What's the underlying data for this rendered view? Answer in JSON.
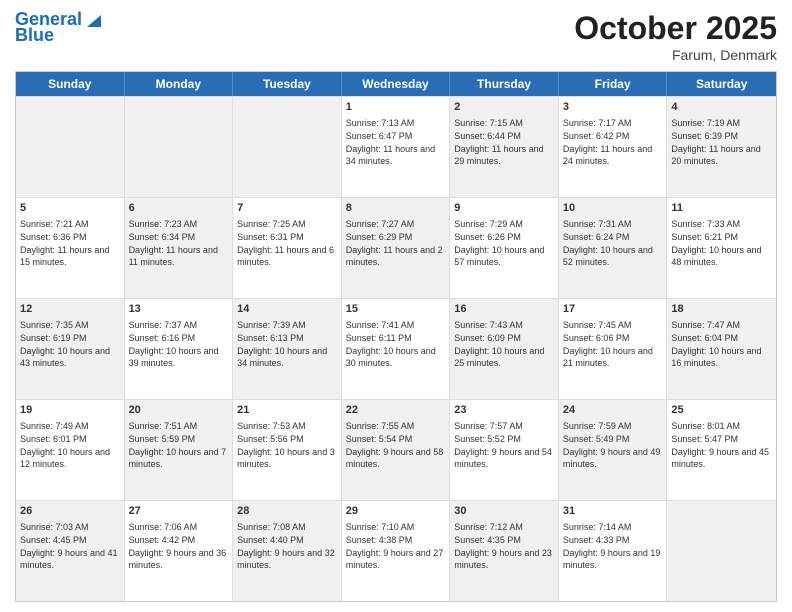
{
  "header": {
    "logo_line1": "General",
    "logo_line2": "Blue",
    "month": "October 2025",
    "location": "Farum, Denmark"
  },
  "days_of_week": [
    "Sunday",
    "Monday",
    "Tuesday",
    "Wednesday",
    "Thursday",
    "Friday",
    "Saturday"
  ],
  "weeks": [
    [
      {
        "day": "",
        "text": "",
        "shaded": true
      },
      {
        "day": "",
        "text": "",
        "shaded": true
      },
      {
        "day": "",
        "text": "",
        "shaded": true
      },
      {
        "day": "1",
        "text": "Sunrise: 7:13 AM\nSunset: 6:47 PM\nDaylight: 11 hours and 34 minutes.",
        "shaded": false
      },
      {
        "day": "2",
        "text": "Sunrise: 7:15 AM\nSunset: 6:44 PM\nDaylight: 11 hours and 29 minutes.",
        "shaded": true
      },
      {
        "day": "3",
        "text": "Sunrise: 7:17 AM\nSunset: 6:42 PM\nDaylight: 11 hours and 24 minutes.",
        "shaded": false
      },
      {
        "day": "4",
        "text": "Sunrise: 7:19 AM\nSunset: 6:39 PM\nDaylight: 11 hours and 20 minutes.",
        "shaded": true
      }
    ],
    [
      {
        "day": "5",
        "text": "Sunrise: 7:21 AM\nSunset: 6:36 PM\nDaylight: 11 hours and 15 minutes.",
        "shaded": false
      },
      {
        "day": "6",
        "text": "Sunrise: 7:23 AM\nSunset: 6:34 PM\nDaylight: 11 hours and 11 minutes.",
        "shaded": true
      },
      {
        "day": "7",
        "text": "Sunrise: 7:25 AM\nSunset: 6:31 PM\nDaylight: 11 hours and 6 minutes.",
        "shaded": false
      },
      {
        "day": "8",
        "text": "Sunrise: 7:27 AM\nSunset: 6:29 PM\nDaylight: 11 hours and 2 minutes.",
        "shaded": true
      },
      {
        "day": "9",
        "text": "Sunrise: 7:29 AM\nSunset: 6:26 PM\nDaylight: 10 hours and 57 minutes.",
        "shaded": false
      },
      {
        "day": "10",
        "text": "Sunrise: 7:31 AM\nSunset: 6:24 PM\nDaylight: 10 hours and 52 minutes.",
        "shaded": true
      },
      {
        "day": "11",
        "text": "Sunrise: 7:33 AM\nSunset: 6:21 PM\nDaylight: 10 hours and 48 minutes.",
        "shaded": false
      }
    ],
    [
      {
        "day": "12",
        "text": "Sunrise: 7:35 AM\nSunset: 6:19 PM\nDaylight: 10 hours and 43 minutes.",
        "shaded": true
      },
      {
        "day": "13",
        "text": "Sunrise: 7:37 AM\nSunset: 6:16 PM\nDaylight: 10 hours and 39 minutes.",
        "shaded": false
      },
      {
        "day": "14",
        "text": "Sunrise: 7:39 AM\nSunset: 6:13 PM\nDaylight: 10 hours and 34 minutes.",
        "shaded": true
      },
      {
        "day": "15",
        "text": "Sunrise: 7:41 AM\nSunset: 6:11 PM\nDaylight: 10 hours and 30 minutes.",
        "shaded": false
      },
      {
        "day": "16",
        "text": "Sunrise: 7:43 AM\nSunset: 6:09 PM\nDaylight: 10 hours and 25 minutes.",
        "shaded": true
      },
      {
        "day": "17",
        "text": "Sunrise: 7:45 AM\nSunset: 6:06 PM\nDaylight: 10 hours and 21 minutes.",
        "shaded": false
      },
      {
        "day": "18",
        "text": "Sunrise: 7:47 AM\nSunset: 6:04 PM\nDaylight: 10 hours and 16 minutes.",
        "shaded": true
      }
    ],
    [
      {
        "day": "19",
        "text": "Sunrise: 7:49 AM\nSunset: 6:01 PM\nDaylight: 10 hours and 12 minutes.",
        "shaded": false
      },
      {
        "day": "20",
        "text": "Sunrise: 7:51 AM\nSunset: 5:59 PM\nDaylight: 10 hours and 7 minutes.",
        "shaded": true
      },
      {
        "day": "21",
        "text": "Sunrise: 7:53 AM\nSunset: 5:56 PM\nDaylight: 10 hours and 3 minutes.",
        "shaded": false
      },
      {
        "day": "22",
        "text": "Sunrise: 7:55 AM\nSunset: 5:54 PM\nDaylight: 9 hours and 58 minutes.",
        "shaded": true
      },
      {
        "day": "23",
        "text": "Sunrise: 7:57 AM\nSunset: 5:52 PM\nDaylight: 9 hours and 54 minutes.",
        "shaded": false
      },
      {
        "day": "24",
        "text": "Sunrise: 7:59 AM\nSunset: 5:49 PM\nDaylight: 9 hours and 49 minutes.",
        "shaded": true
      },
      {
        "day": "25",
        "text": "Sunrise: 8:01 AM\nSunset: 5:47 PM\nDaylight: 9 hours and 45 minutes.",
        "shaded": false
      }
    ],
    [
      {
        "day": "26",
        "text": "Sunrise: 7:03 AM\nSunset: 4:45 PM\nDaylight: 9 hours and 41 minutes.",
        "shaded": true
      },
      {
        "day": "27",
        "text": "Sunrise: 7:06 AM\nSunset: 4:42 PM\nDaylight: 9 hours and 36 minutes.",
        "shaded": false
      },
      {
        "day": "28",
        "text": "Sunrise: 7:08 AM\nSunset: 4:40 PM\nDaylight: 9 hours and 32 minutes.",
        "shaded": true
      },
      {
        "day": "29",
        "text": "Sunrise: 7:10 AM\nSunset: 4:38 PM\nDaylight: 9 hours and 27 minutes.",
        "shaded": false
      },
      {
        "day": "30",
        "text": "Sunrise: 7:12 AM\nSunset: 4:35 PM\nDaylight: 9 hours and 23 minutes.",
        "shaded": true
      },
      {
        "day": "31",
        "text": "Sunrise: 7:14 AM\nSunset: 4:33 PM\nDaylight: 9 hours and 19 minutes.",
        "shaded": false
      },
      {
        "day": "",
        "text": "",
        "shaded": true
      }
    ]
  ]
}
